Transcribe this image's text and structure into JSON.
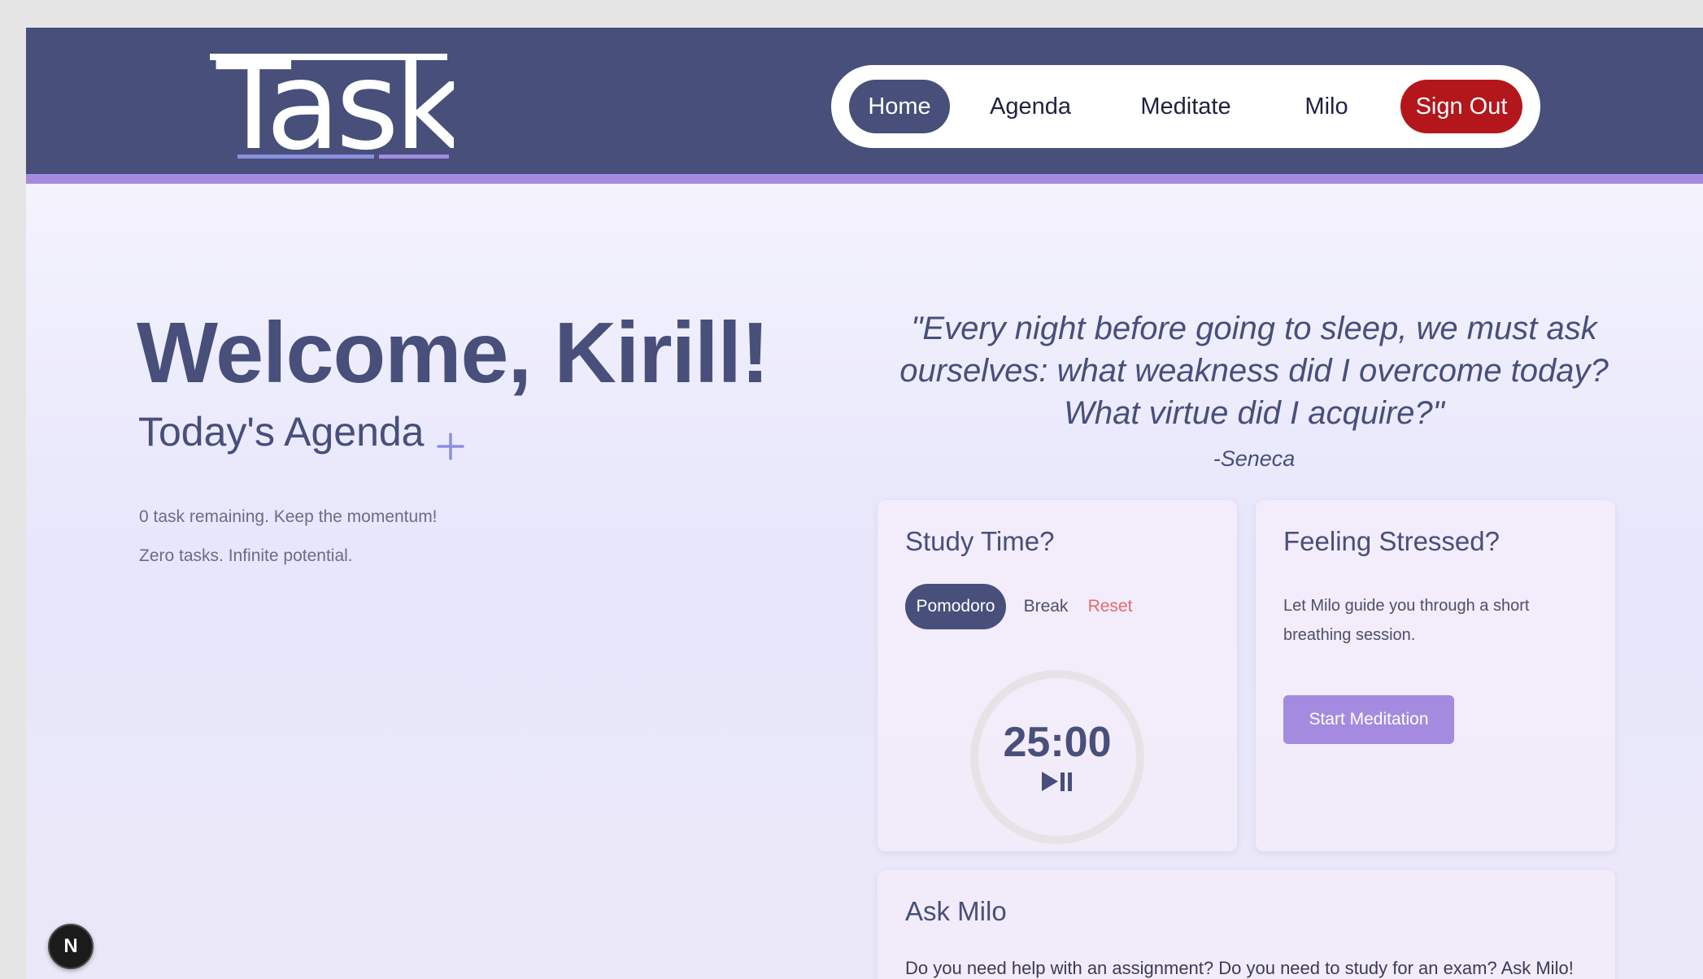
{
  "header": {
    "logo_text": "Taskl",
    "nav": [
      {
        "label": "Home"
      },
      {
        "label": "Agenda"
      },
      {
        "label": "Meditate"
      },
      {
        "label": "Milo"
      },
      {
        "label": "Sign Out"
      }
    ]
  },
  "main": {
    "welcome": "Welcome, Kirill!",
    "agenda_title": "Today's Agenda",
    "agenda_remaining": "0 task remaining. Keep the momentum!",
    "agenda_empty": "Zero tasks. Infinite potential."
  },
  "quote": {
    "text": "\"Every night before going to sleep, we must ask ourselves: what weakness did I overcome today? What virtue did I acquire?\"",
    "author": "-Seneca"
  },
  "study": {
    "title": "Study Time?",
    "modes": [
      "Pomodoro",
      "Break"
    ],
    "reset_label": "Reset",
    "timer": "25:00"
  },
  "stress": {
    "title": "Feeling Stressed?",
    "text": "Let Milo guide you through a short breathing session.",
    "button": "Start Meditation"
  },
  "milo": {
    "title": "Ask Milo",
    "text": "Do you need help with an assignment? Do you need to study for an exam? Ask Milo!"
  },
  "dev_badge": "N",
  "colors": {
    "primary": "#474f7a",
    "accent": "#a48be0",
    "danger": "#b3171c",
    "reset": "#e36b6b"
  },
  "icons": [
    "plus-icon",
    "play-pause-icon"
  ]
}
